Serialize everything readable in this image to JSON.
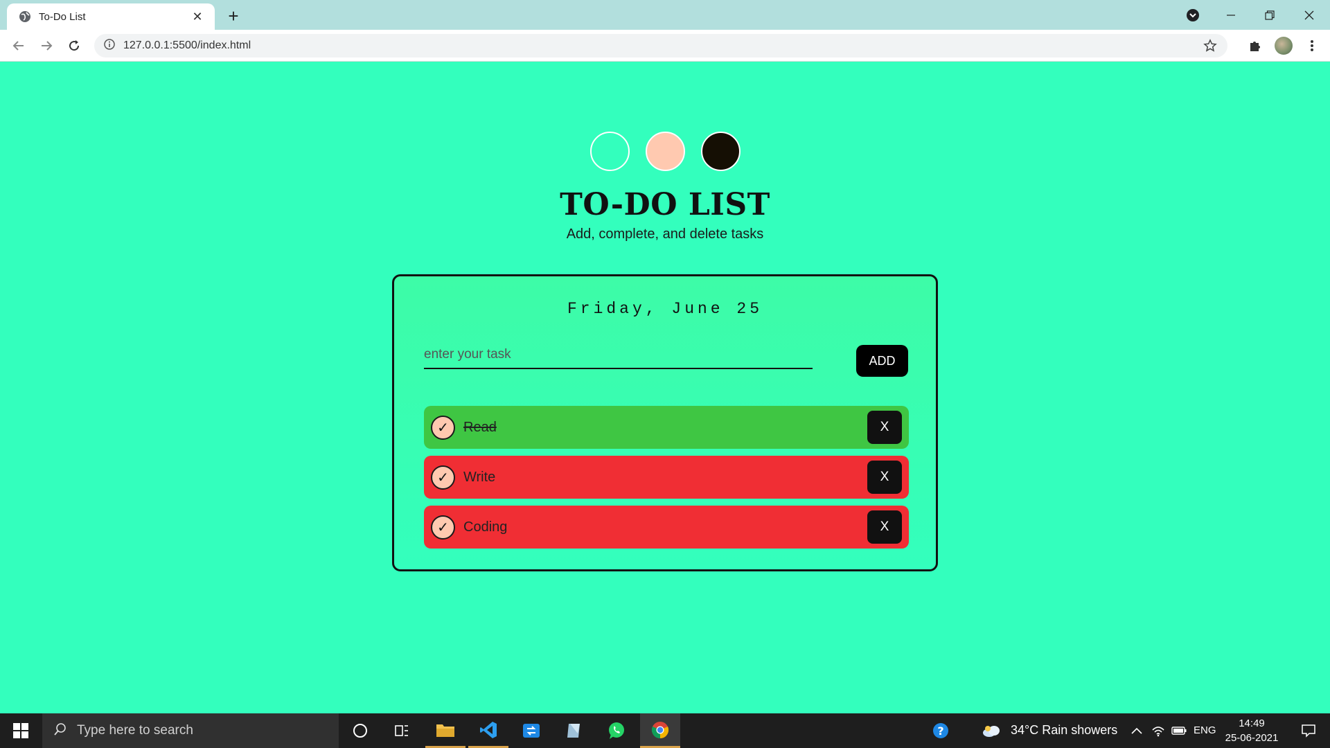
{
  "browser": {
    "tab_title": "To-Do List",
    "url": "127.0.0.1:5500/index.html",
    "new_tab_symbol": "+",
    "close_symbol": "✕"
  },
  "page": {
    "title": "TO-DO LIST",
    "subtitle": "Add, complete, and delete tasks",
    "theme_options": [
      {
        "name": "mint",
        "color": "#33ffbd"
      },
      {
        "name": "peach",
        "color": "#ffc9b0"
      },
      {
        "name": "dark",
        "color": "#150f04"
      }
    ],
    "date": "Friday, June 25",
    "input_placeholder": "enter your task",
    "add_label": "ADD",
    "tasks": [
      {
        "label": "Read",
        "completed": true,
        "check": "✓",
        "delete": "X"
      },
      {
        "label": "Write",
        "completed": false,
        "check": "✓",
        "delete": "X"
      },
      {
        "label": "Coding",
        "completed": false,
        "check": "✓",
        "delete": "X"
      }
    ],
    "colors": {
      "background": "#33ffbd",
      "completed": "#3fc643",
      "pending": "#f02e34",
      "button": "#000000"
    }
  },
  "taskbar": {
    "search_placeholder": "Type here to search",
    "weather": "34°C  Rain showers",
    "language": "ENG",
    "time": "14:49",
    "date": "25-06-2021"
  }
}
